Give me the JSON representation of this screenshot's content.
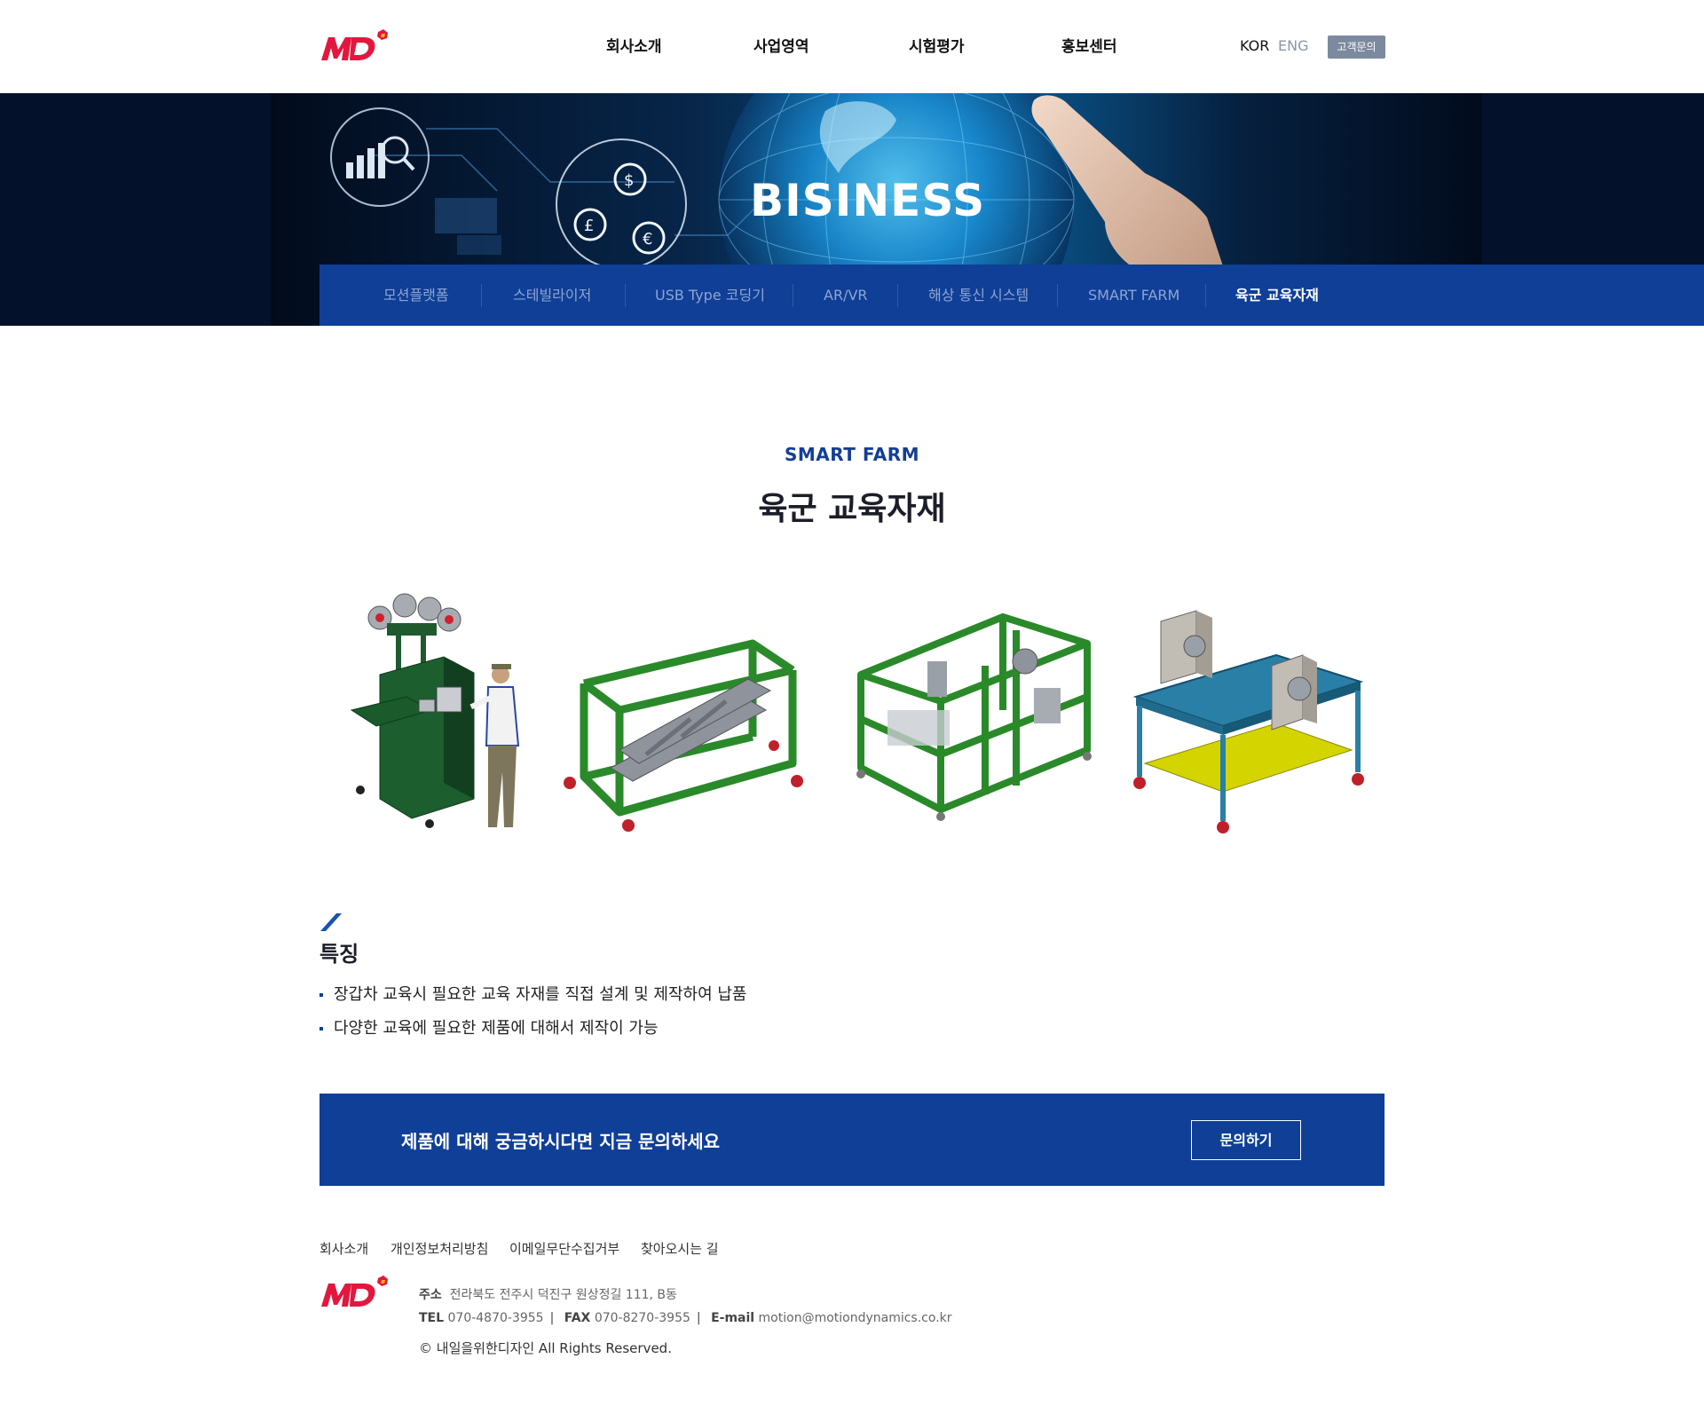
{
  "header": {
    "gnb": [
      "회사소개",
      "사업영역",
      "시험평가",
      "홍보센터"
    ],
    "lang_kor": "KOR",
    "lang_eng": "ENG",
    "cs_label": "고객문의"
  },
  "hero": {
    "title": "BISINESS"
  },
  "subnav": {
    "items": [
      "모션플랫폼",
      "스테빌라이저",
      "USB Type 코딩기",
      "AR/VR",
      "해상 통신 시스템",
      "SMART FARM",
      "육군 교육자재"
    ],
    "active_index": 6
  },
  "content": {
    "eyebrow": "SMART FARM",
    "title": "육군 교육자재",
    "products": [
      "control-cabinet-with-operator",
      "inclined-track-frame",
      "enclosed-test-frame",
      "blue-workbench-with-motors"
    ],
    "feature_title": "특징",
    "features": [
      "장갑차 교육시 필요한 교육 자재를 직접 설계 및 제작하여 납품",
      "다양한 교육에 필요한 제품에 대해서 제작이 가능"
    ]
  },
  "cta": {
    "text": "제품에 대해 궁금하시다면 지금 문의하세요",
    "button": "문의하기"
  },
  "footer": {
    "links": [
      "회사소개",
      "개인정보처리방침",
      "이메일무단수집거부",
      "찾아오시는 길"
    ],
    "address_label": "주소",
    "address": "전라북도 전주시 덕진구 원상정길 111, B동",
    "tel_label": "TEL",
    "tel": "070-4870-3955",
    "fax_label": "FAX",
    "fax": "070-8270-3955",
    "email_label": "E-mail",
    "email": "motion@motiondynamics.co.kr",
    "copyright": "© 내일을위한디자인  All Rights Reserved."
  },
  "colors": {
    "brand_blue": "#0f3f96",
    "logo_red": "#e3173e",
    "frame_green": "#2a8a2a",
    "table_blue": "#2a7fa6",
    "table_yellow": "#d4d400"
  }
}
